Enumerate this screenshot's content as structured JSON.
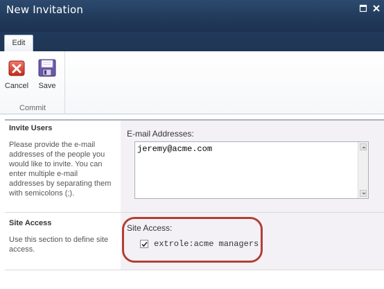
{
  "window": {
    "title": "New Invitation",
    "max_icon": "maximize-icon",
    "close_icon": "close-icon"
  },
  "ribbon": {
    "tabs": [
      {
        "label": "Edit",
        "selected": true
      }
    ],
    "groups": [
      {
        "label": "Commit",
        "buttons": [
          {
            "label": "Cancel",
            "icon": "cancel-icon"
          },
          {
            "label": "Save",
            "icon": "save-icon"
          }
        ]
      }
    ]
  },
  "form": {
    "invite_users": {
      "title": "Invite Users",
      "description": "Please provide the e-mail addresses of the people you would like to invite. You can enter multiple e-mail addresses by separating them with semicolons (;).",
      "field_label": "E-mail Addresses:",
      "value": "jeremy@acme.com"
    },
    "site_access": {
      "title": "Site Access",
      "description": "Use this section to define site access.",
      "field_label": "Site Access:",
      "checkbox_label": "extrole:acme managers",
      "checked": true
    }
  },
  "colors": {
    "titlebar": "#21395a",
    "highlight_ring": "#b23f33",
    "field_panel": "#f4f1f6"
  }
}
